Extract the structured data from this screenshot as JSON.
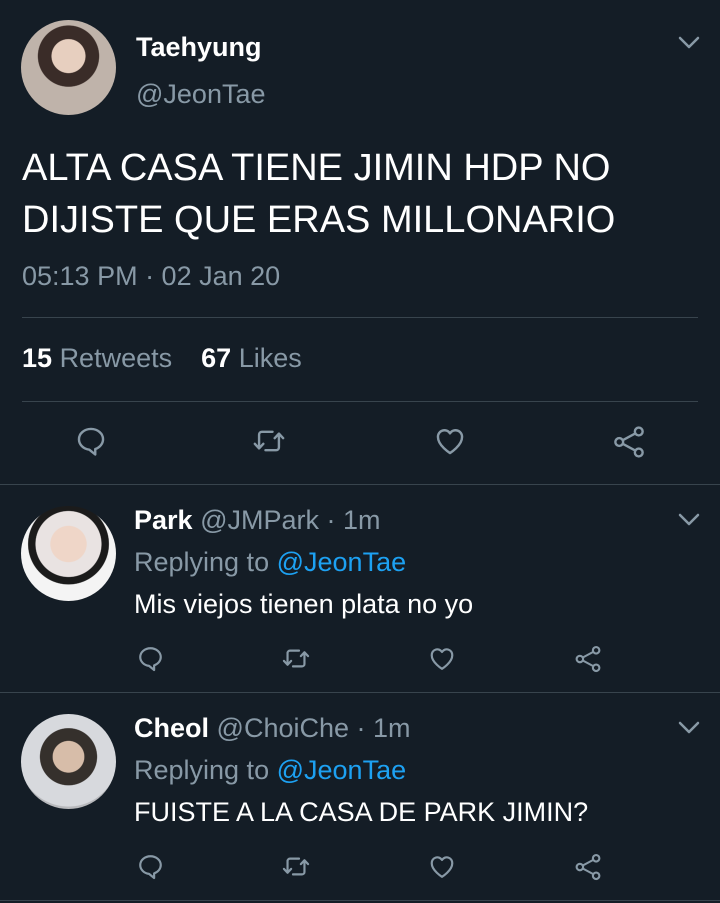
{
  "main_tweet": {
    "name": "Taehyung",
    "handle": "@JeonTae",
    "text_line1": "ALTA CASA TIENE JIMIN HDP NO",
    "text_line2": "DIJISTE QUE ERAS MILLONARIO",
    "timestamp": "05:13 PM · 02 Jan 20",
    "retweets_count": "15",
    "retweets_label": "Retweets",
    "likes_count": "67",
    "likes_label": "Likes"
  },
  "replies": [
    {
      "name": "Park",
      "handle": "@JMPark",
      "time": "· 1m",
      "replying_prefix": "Replying to",
      "replying_to": "@JeonTae",
      "text": "Mis viejos tienen plata no yo"
    },
    {
      "name": "Cheol",
      "handle": "@ChoiChe",
      "time": "· 1m",
      "replying_prefix": "Replying to",
      "replying_to": "@JeonTae",
      "text": "FUISTE A LA CASA DE PARK JIMIN?"
    }
  ],
  "icons": {
    "more": "chevron-down-icon",
    "reply": "reply-icon",
    "retweet": "retweet-icon",
    "like": "heart-icon",
    "share": "share-icon"
  },
  "colors": {
    "background": "#141d26",
    "muted": "#8899a6",
    "link": "#1da1f2",
    "divider": "#38444d"
  }
}
